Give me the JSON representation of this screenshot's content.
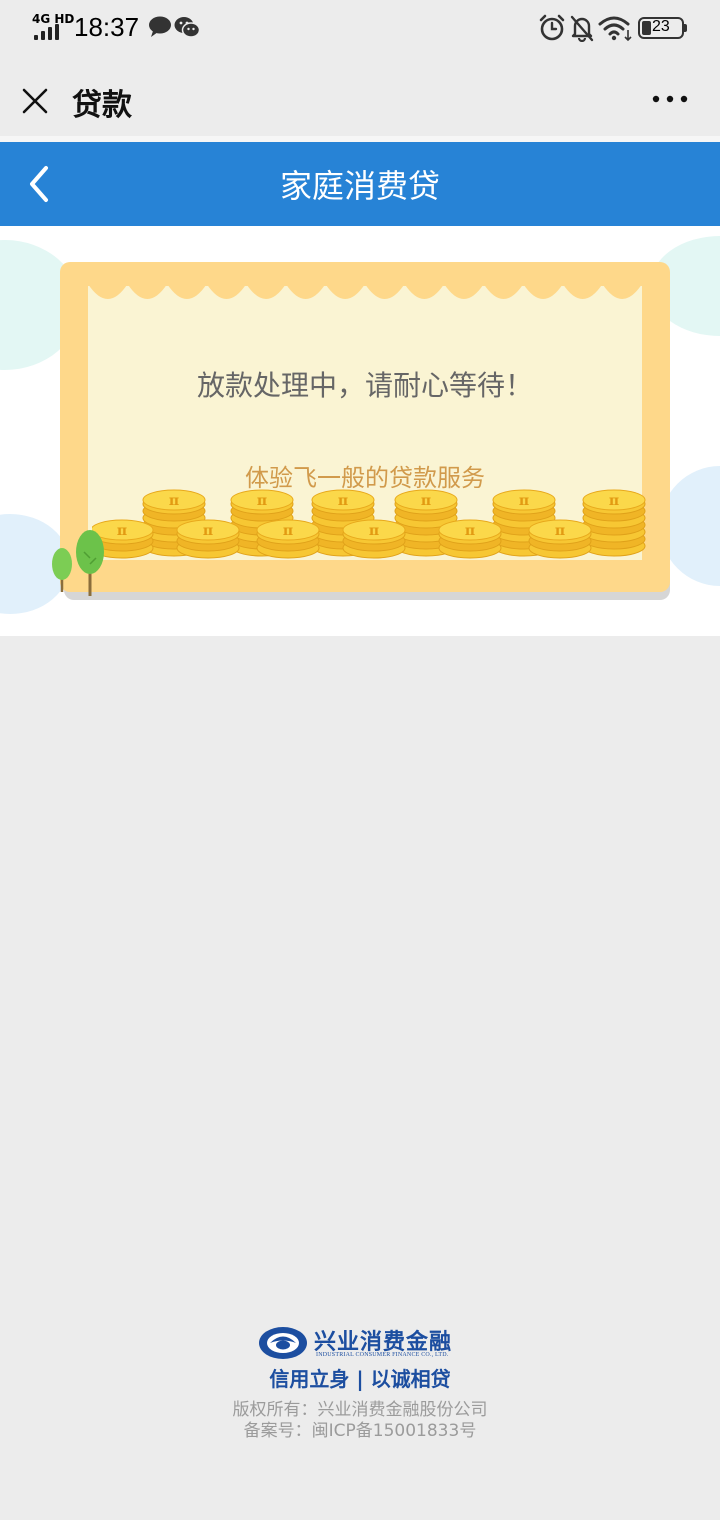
{
  "status_bar": {
    "network": "4G HD",
    "time": "18:37",
    "battery": "23"
  },
  "nav": {
    "title": "贷款"
  },
  "header": {
    "title": "家庭消费贷"
  },
  "content": {
    "status_message": "放款处理中，请耐心等待！",
    "slogan": "体验飞一般的贷款服务"
  },
  "footer": {
    "brand_cn": "兴业消费金融",
    "brand_en": "INDUSTRIAL CONSUMER FINANCE CO., LTD.",
    "slogan": "信用立身 | 以诚相贷",
    "copyright": "版权所有：兴业消费金融股份公司",
    "icp": "备案号：闽ICP备15001833号"
  },
  "colors": {
    "header_blue": "#2783d6",
    "card_orange": "#fed88a",
    "card_inner": "#faf4d3",
    "slogan_text": "#d19a4b",
    "brand_blue": "#1c4ea0"
  },
  "icons": [
    "close-icon",
    "more-icon",
    "back-icon",
    "alarm-icon",
    "bell-off-icon",
    "wifi-icon",
    "message-icon",
    "wechat-icon",
    "coin-icon",
    "tree-icon",
    "company-logo-icon"
  ]
}
